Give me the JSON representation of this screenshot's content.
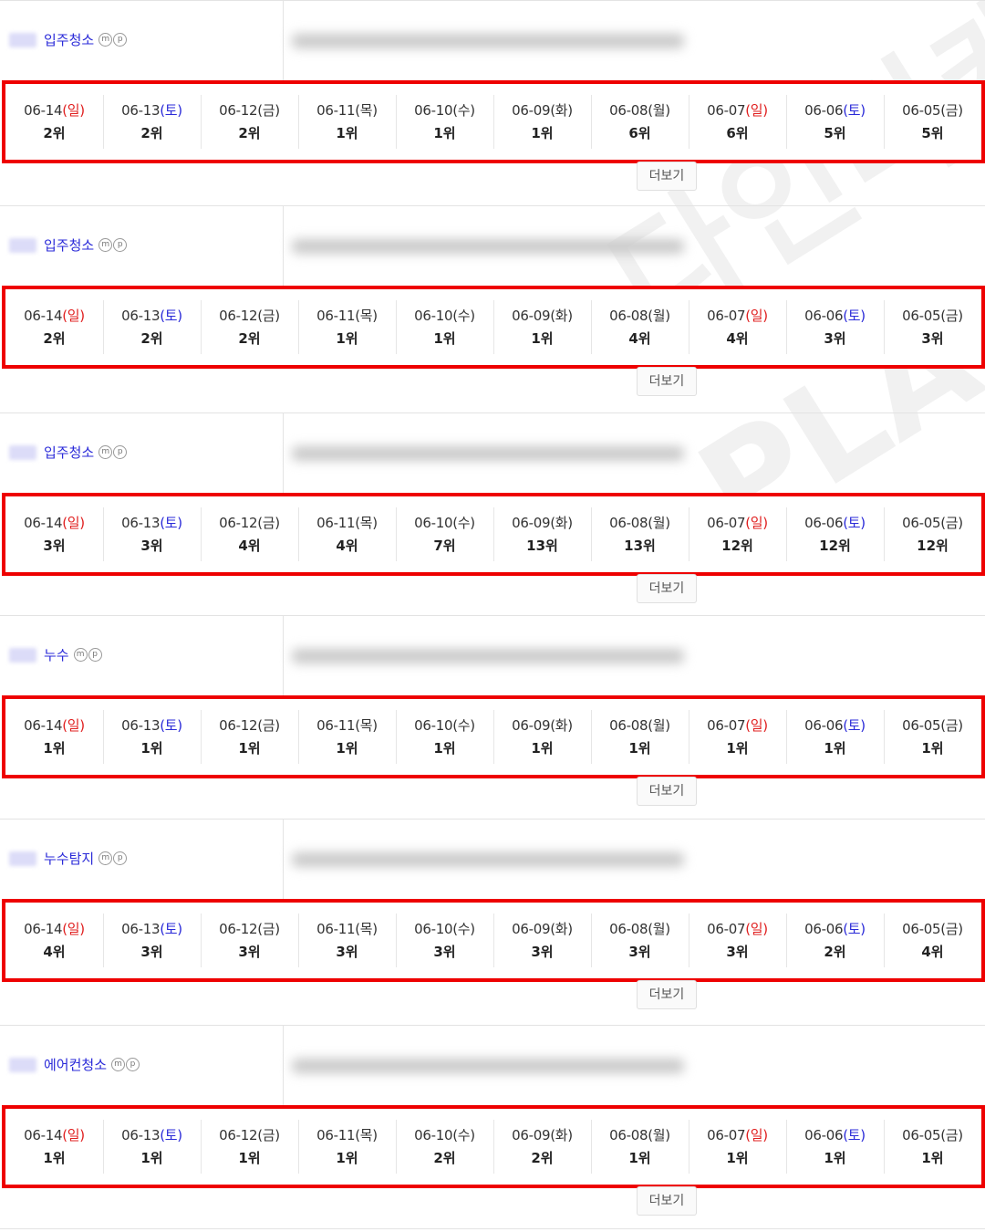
{
  "more_label": "더보기",
  "icon_m": "m",
  "icon_p": "p",
  "watermarks": [
    "다인마케",
    "PLA"
  ],
  "day_colors": {
    "sun": "#e02020",
    "sat": "#2a2ad8",
    "normal": "#333333"
  },
  "accent_border": "#ee0000",
  "dates": [
    {
      "date": "06-14",
      "day": "(일)",
      "kind": "sun"
    },
    {
      "date": "06-13",
      "day": "(토)",
      "kind": "sat"
    },
    {
      "date": "06-12",
      "day": "(금)",
      "kind": "normal"
    },
    {
      "date": "06-11",
      "day": "(목)",
      "kind": "normal"
    },
    {
      "date": "06-10",
      "day": "(수)",
      "kind": "normal"
    },
    {
      "date": "06-09",
      "day": "(화)",
      "kind": "normal"
    },
    {
      "date": "06-08",
      "day": "(월)",
      "kind": "normal"
    },
    {
      "date": "06-07",
      "day": "(일)",
      "kind": "sun"
    },
    {
      "date": "06-06",
      "day": "(토)",
      "kind": "sat"
    },
    {
      "date": "06-05",
      "day": "(금)",
      "kind": "normal"
    }
  ],
  "keywords": [
    {
      "keyword": "입주청소",
      "ranks": [
        "2위",
        "2위",
        "2위",
        "1위",
        "1위",
        "1위",
        "6위",
        "6위",
        "5위",
        "5위"
      ]
    },
    {
      "keyword": "입주청소",
      "ranks": [
        "2위",
        "2위",
        "2위",
        "1위",
        "1위",
        "1위",
        "4위",
        "4위",
        "3위",
        "3위"
      ]
    },
    {
      "keyword": "입주청소",
      "ranks": [
        "3위",
        "3위",
        "4위",
        "4위",
        "7위",
        "13위",
        "13위",
        "12위",
        "12위",
        "12위"
      ]
    },
    {
      "keyword": "누수",
      "ranks": [
        "1위",
        "1위",
        "1위",
        "1위",
        "1위",
        "1위",
        "1위",
        "1위",
        "1위",
        "1위"
      ]
    },
    {
      "keyword": "누수탐지",
      "ranks": [
        "4위",
        "3위",
        "3위",
        "3위",
        "3위",
        "3위",
        "3위",
        "3위",
        "2위",
        "4위"
      ]
    },
    {
      "keyword": "에어컨청소",
      "ranks": [
        "1위",
        "1위",
        "1위",
        "1위",
        "2위",
        "2위",
        "1위",
        "1위",
        "1위",
        "1위"
      ]
    }
  ]
}
